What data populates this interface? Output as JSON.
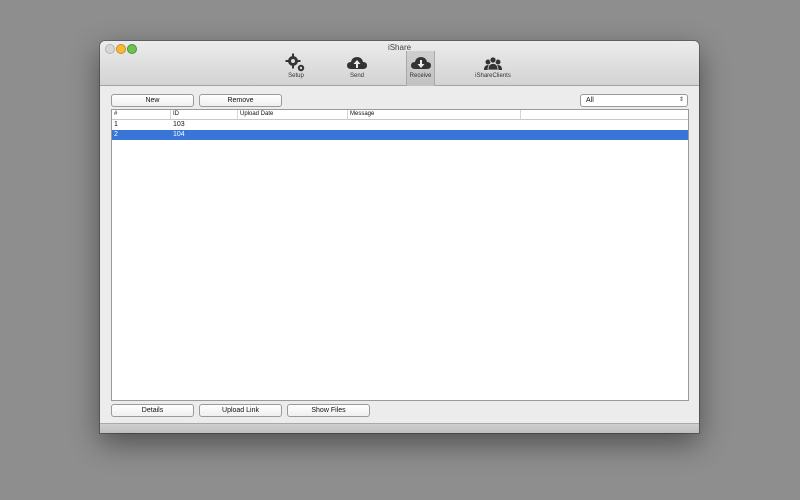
{
  "window": {
    "title": "iShare"
  },
  "toolbar": {
    "items": [
      {
        "label": "Setup",
        "icon": "gears-icon"
      },
      {
        "label": "Send",
        "icon": "cloud-upload-icon"
      },
      {
        "label": "Receive",
        "icon": "cloud-download-icon",
        "selected": true
      },
      {
        "label": "iShareClients",
        "icon": "users-icon"
      }
    ]
  },
  "actions": {
    "new_label": "New",
    "remove_label": "Remove"
  },
  "filter": {
    "value": "All",
    "options": [
      "All"
    ]
  },
  "table": {
    "columns": [
      "#",
      "ID",
      "Upload Date",
      "Message",
      ""
    ],
    "rows": [
      {
        "num": "1",
        "id": "103",
        "upload_date": "",
        "message": ""
      },
      {
        "num": "2",
        "id": "104",
        "upload_date": "",
        "message": "",
        "selected": true
      }
    ]
  },
  "footer": {
    "details_label": "Details",
    "upload_link_label": "Upload Link",
    "show_files_label": "Show Files"
  },
  "colors": {
    "selection": "#3875d7",
    "desktop": "#8e8e8e",
    "window": "#ececec"
  }
}
